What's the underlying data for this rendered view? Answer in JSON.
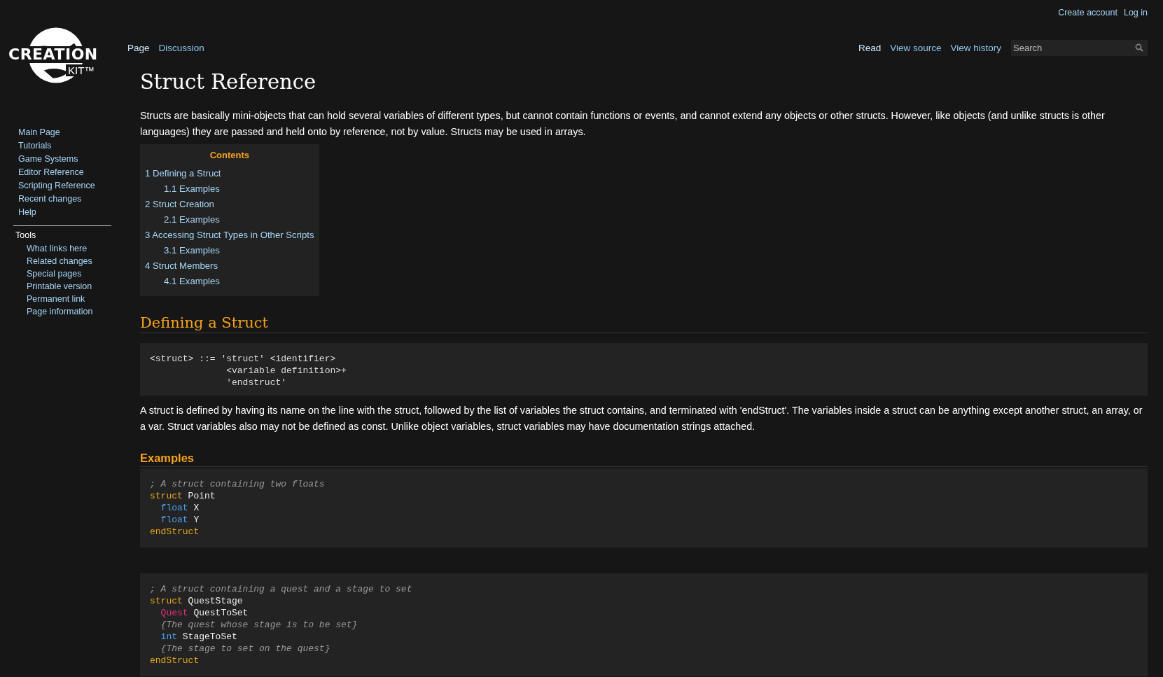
{
  "logo": {
    "word": "CREATION",
    "sub": "KIT™"
  },
  "personal_links": [
    "Create account",
    "Log in"
  ],
  "namespace_tabs": [
    {
      "label": "Page",
      "selected": true
    },
    {
      "label": "Discussion",
      "selected": false
    }
  ],
  "view_tabs": [
    {
      "label": "Read",
      "selected": true
    },
    {
      "label": "View source",
      "selected": false
    },
    {
      "label": "View history",
      "selected": false
    }
  ],
  "search": {
    "placeholder": "Search"
  },
  "sidebar": {
    "navigation": [
      "Main Page",
      "Tutorials",
      "Game Systems",
      "Editor Reference",
      "Scripting Reference",
      "Recent changes",
      "Help"
    ],
    "tools_heading": "Tools",
    "tools": [
      "What links here",
      "Related changes",
      "Special pages",
      "Printable version",
      "Permanent link",
      "Page information"
    ]
  },
  "title": "Struct Reference",
  "intro": "Structs are basically mini-objects that can hold several variables of different types, but cannot contain functions or events, and cannot extend any objects or other structs. However, like objects (and unlike structs is other languages) they are passed and held onto by reference, not by value. Structs may be used in arrays.",
  "toc": {
    "heading": "Contents",
    "items": [
      {
        "number": "1",
        "label": "Defining a Struct",
        "children": [
          {
            "number": "1.1",
            "label": "Examples"
          }
        ]
      },
      {
        "number": "2",
        "label": "Struct Creation",
        "children": [
          {
            "number": "2.1",
            "label": "Examples"
          }
        ]
      },
      {
        "number": "3",
        "label": "Accessing Struct Types in Other Scripts",
        "children": [
          {
            "number": "3.1",
            "label": "Examples"
          }
        ]
      },
      {
        "number": "4",
        "label": "Struct Members",
        "children": [
          {
            "number": "4.1",
            "label": "Examples"
          }
        ]
      }
    ]
  },
  "section": {
    "heading": "Defining a Struct",
    "grammar": [
      "<struct> ::= 'struct' <identifier>",
      "              <variable definition>+",
      "              'endstruct'"
    ],
    "text": "A struct is defined by having its name on the line with the struct, followed by the list of variables the struct contains, and terminated with 'endStruct'. The variables inside a struct can be anything except another struct, an array, or a var. Struct variables also may not be defined as const. Unlike object variables, struct variables may have documentation strings attached.",
    "subheading": "Examples",
    "examples": [
      [
        [
          {
            "kind": "comment",
            "text": "; A struct containing two floats"
          }
        ],
        [
          {
            "kind": "keyword",
            "text": "struct"
          },
          {
            "kind": "plain",
            "text": " Point"
          }
        ],
        [
          {
            "kind": "type",
            "text": "  float"
          },
          {
            "kind": "plain",
            "text": " X"
          }
        ],
        [
          {
            "kind": "type",
            "text": "  float"
          },
          {
            "kind": "plain",
            "text": " Y"
          }
        ],
        [
          {
            "kind": "keyword",
            "text": "endStruct"
          }
        ]
      ],
      [
        [
          {
            "kind": "comment",
            "text": "; A struct containing a quest and a stage to set"
          }
        ],
        [
          {
            "kind": "keyword",
            "text": "struct"
          },
          {
            "kind": "plain",
            "text": " QuestStage"
          }
        ],
        [
          {
            "kind": "class",
            "text": "  Quest"
          },
          {
            "kind": "plain",
            "text": " QuestToSet"
          }
        ],
        [
          {
            "kind": "comment",
            "text": "  {The quest whose stage is to be set}"
          }
        ],
        [
          {
            "kind": "type",
            "text": "  int"
          },
          {
            "kind": "plain",
            "text": " StageToSet"
          }
        ],
        [
          {
            "kind": "comment",
            "text": "  {The stage to set on the quest}"
          }
        ],
        [
          {
            "kind": "keyword",
            "text": "endStruct"
          }
        ]
      ]
    ]
  }
}
